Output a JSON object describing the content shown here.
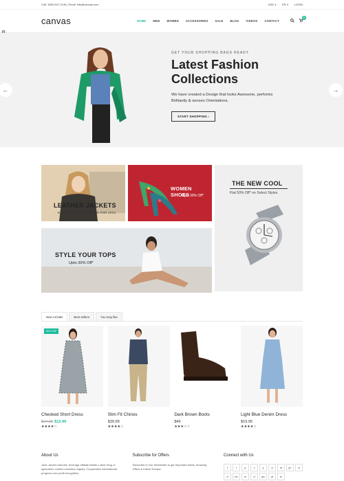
{
  "topbar": {
    "contact": "Call: 1800-547-2145 | Email: info@canvas.com",
    "currency": "USD ∨",
    "language": "EN ∨",
    "login": "LOGIN"
  },
  "header": {
    "logo": "canvas",
    "nav": [
      {
        "label": "HOME"
      },
      {
        "label": "MEN"
      },
      {
        "label": "WOMEN"
      },
      {
        "label": "ACCESSORIES"
      },
      {
        "label": "SALE"
      },
      {
        "label": "BLOG"
      },
      {
        "label": "VIDEOS"
      },
      {
        "label": "CONTACT"
      }
    ],
    "cart_count": "0"
  },
  "hero": {
    "eyebrow": "GET YOUR SHOPPING BAGS READY",
    "title_line1": "Latest Fashion",
    "title_line2": "Collections",
    "description": "We have created a Design that looks Awesome, performs Brilliantly & senses Orientations.",
    "button": "START SHOPPING ›",
    "arrow_left": "←",
    "arrow_right": "→"
  },
  "promo": {
    "leather_title": "LEATHER JACKETS",
    "leather_sub": "EXCLUSIVE COLLECTION FOR 2015",
    "shoes_title": "WOMEN SHOES",
    "shoes_sub": "Upto 30% Off*",
    "cool_title": "THE NEW COOL",
    "cool_sub": "Flat 50% Off* on Select Styles",
    "tops_title": "STYLE YOUR TOPS",
    "tops_sub": "Upto 30% Off*"
  },
  "tabs": [
    {
      "label": "New Arrivals"
    },
    {
      "label": "Best sellers"
    },
    {
      "label": "You may like"
    }
  ],
  "products": [
    {
      "name": "Checked Short Dress",
      "old_price": "$24.99",
      "price": "$12.49",
      "badge": "50% Off*",
      "stars": "★★★★☆",
      "rating": 4
    },
    {
      "name": "Slim Fit Chinos",
      "old_price": "",
      "price": "$39.99",
      "badge": "",
      "stars": "★★★★☆",
      "rating": 3.5
    },
    {
      "name": "Dark Brown Boots",
      "old_price": "",
      "price": "$49",
      "badge": "",
      "stars": "★★★☆☆",
      "rating": 3
    },
    {
      "name": "Light Blue Denim Dress",
      "old_price": "",
      "price": "$19.95",
      "badge": "",
      "stars": "★★★★☆",
      "rating": 4
    }
  ],
  "footer": {
    "about_title": "About Us",
    "about_text": "Jane Jacobs educate, leverage affiliate Martin Luther King Jr. agriculture conflict resolution dignity. Cooperative International progress non-profit recognition.",
    "subscribe_title": "Subscribe for Offers",
    "subscribe_text": "Subscribe to Our Newsletter to get Important News, Amazing Offers & Inside Scoops:",
    "connect_title": "Connect with Us",
    "social": [
      "f",
      "t",
      "p",
      "v",
      "y",
      "a",
      "m",
      "g+",
      "vi",
      "d",
      "be",
      "in",
      "d",
      "gh",
      "yt",
      "w"
    ]
  },
  "colors": {
    "accent": "#1abc9c",
    "hero_bg": "#f2f2f2"
  }
}
